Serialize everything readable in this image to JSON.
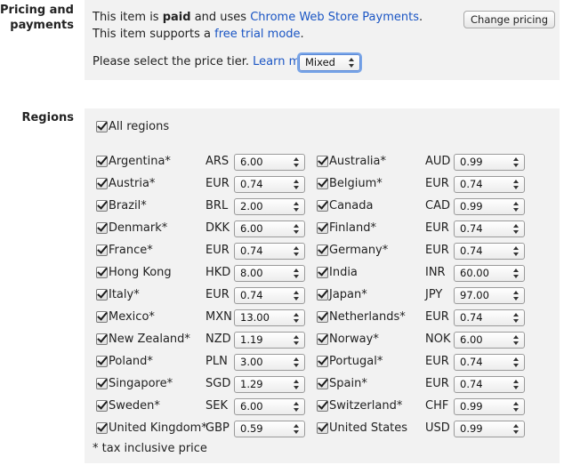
{
  "pricing": {
    "section_label_line1": "Pricing and",
    "section_label_line2": "payments",
    "line1_prefix": "This item is ",
    "line1_bold": "paid",
    "line1_mid": " and uses ",
    "line1_link": "Chrome Web Store Payments",
    "line1_suffix": ".",
    "line2_prefix": "This item supports a ",
    "line2_link": "free trial mode",
    "line2_suffix": ".",
    "tier_prompt": "Please select the price tier. ",
    "learn_more": "Learn more",
    "tier_value": "Mixed",
    "change_button": "Change pricing"
  },
  "regions": {
    "section_label": "Regions",
    "all_regions_label": "All regions",
    "all_regions_checked": true,
    "footnote": "* tax inclusive price",
    "left_column": [
      {
        "name": "Argentina*",
        "currency": "ARS",
        "price": "6.00",
        "checked": true
      },
      {
        "name": "Austria*",
        "currency": "EUR",
        "price": "0.74",
        "checked": true
      },
      {
        "name": "Brazil*",
        "currency": "BRL",
        "price": "2.00",
        "checked": true
      },
      {
        "name": "Denmark*",
        "currency": "DKK",
        "price": "6.00",
        "checked": true
      },
      {
        "name": "France*",
        "currency": "EUR",
        "price": "0.74",
        "checked": true
      },
      {
        "name": "Hong Kong",
        "currency": "HKD",
        "price": "8.00",
        "checked": true
      },
      {
        "name": "Italy*",
        "currency": "EUR",
        "price": "0.74",
        "checked": true
      },
      {
        "name": "Mexico*",
        "currency": "MXN",
        "price": "13.00",
        "checked": true
      },
      {
        "name": "New Zealand*",
        "currency": "NZD",
        "price": "1.19",
        "checked": true
      },
      {
        "name": "Poland*",
        "currency": "PLN",
        "price": "3.00",
        "checked": true
      },
      {
        "name": "Singapore*",
        "currency": "SGD",
        "price": "1.29",
        "checked": true
      },
      {
        "name": "Sweden*",
        "currency": "SEK",
        "price": "6.00",
        "checked": true
      },
      {
        "name": "United Kingdom*",
        "currency": "GBP",
        "price": "0.59",
        "checked": true
      }
    ],
    "right_column": [
      {
        "name": "Australia*",
        "currency": "AUD",
        "price": "0.99",
        "checked": true
      },
      {
        "name": "Belgium*",
        "currency": "EUR",
        "price": "0.74",
        "checked": true
      },
      {
        "name": "Canada",
        "currency": "CAD",
        "price": "0.99",
        "checked": true
      },
      {
        "name": "Finland*",
        "currency": "EUR",
        "price": "0.74",
        "checked": true
      },
      {
        "name": "Germany*",
        "currency": "EUR",
        "price": "0.74",
        "checked": true
      },
      {
        "name": "India",
        "currency": "INR",
        "price": "60.00",
        "checked": true
      },
      {
        "name": "Japan*",
        "currency": "JPY",
        "price": "97.00",
        "checked": true
      },
      {
        "name": "Netherlands*",
        "currency": "EUR",
        "price": "0.74",
        "checked": true
      },
      {
        "name": "Norway*",
        "currency": "NOK",
        "price": "6.00",
        "checked": true
      },
      {
        "name": "Portugal*",
        "currency": "EUR",
        "price": "0.74",
        "checked": true
      },
      {
        "name": "Spain*",
        "currency": "EUR",
        "price": "0.74",
        "checked": true
      },
      {
        "name": "Switzerland*",
        "currency": "CHF",
        "price": "0.99",
        "checked": true
      },
      {
        "name": "United States",
        "currency": "USD",
        "price": "0.99",
        "checked": true
      }
    ]
  }
}
